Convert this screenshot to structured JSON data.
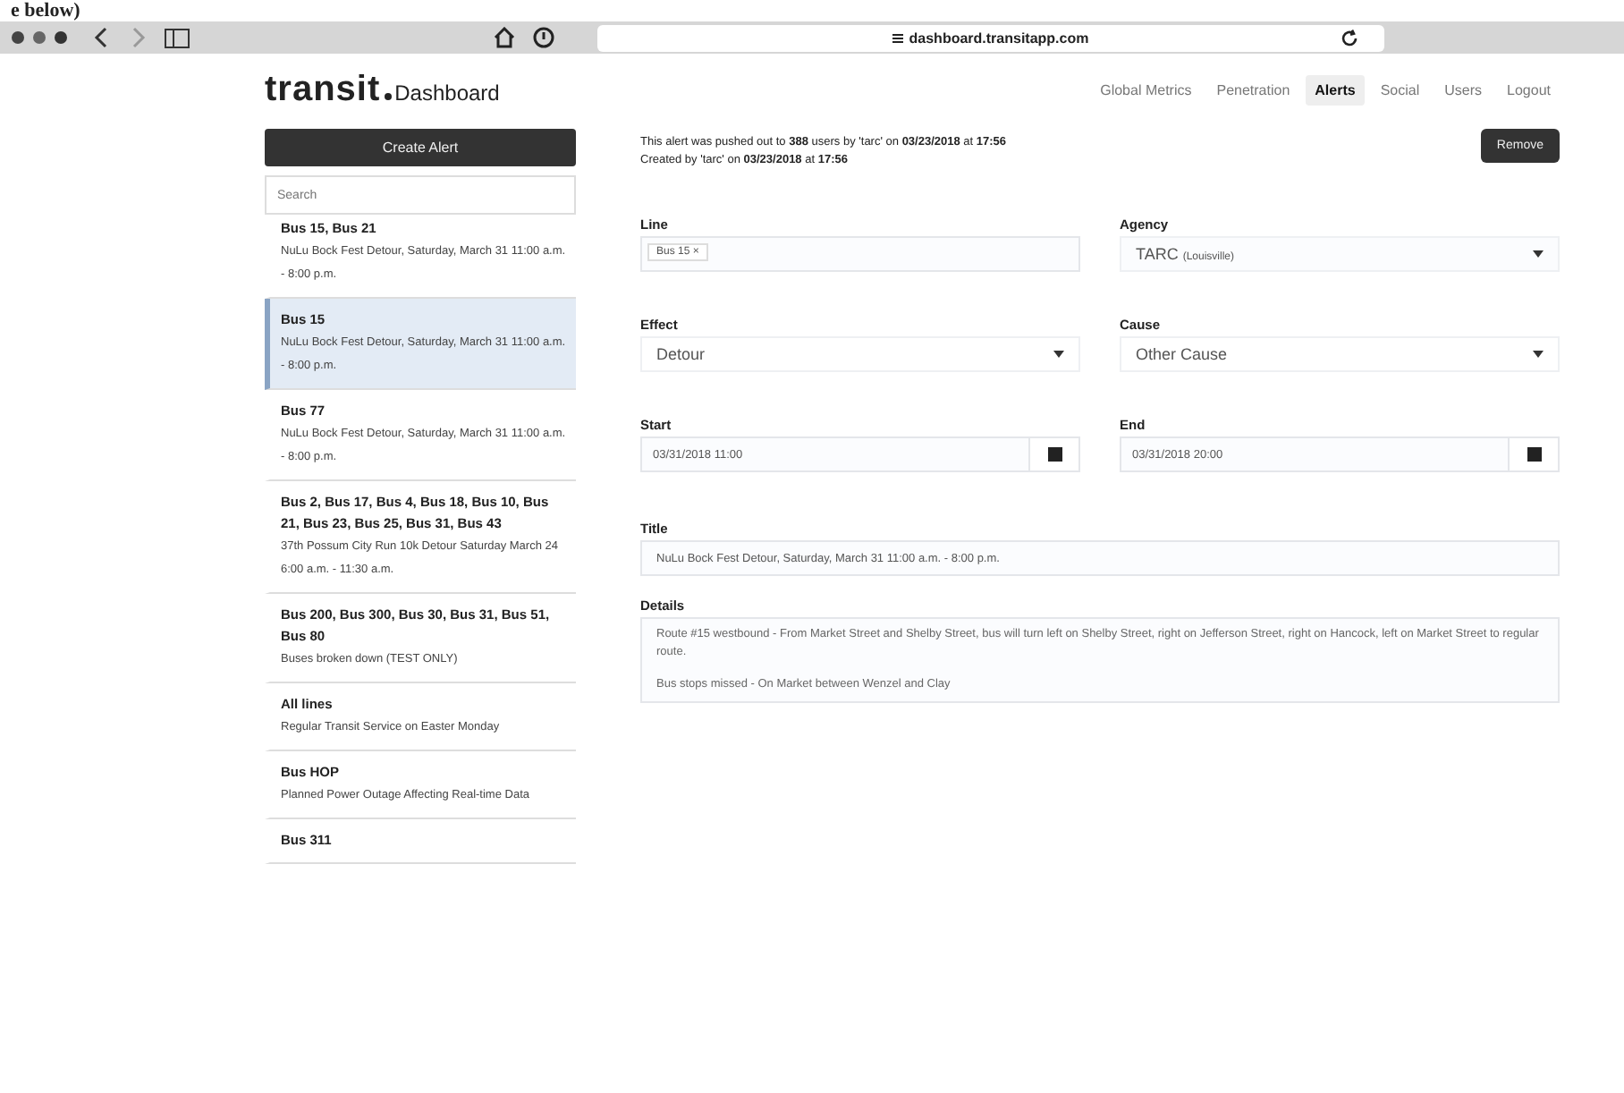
{
  "caption": "e below)",
  "browser": {
    "url": "dashboard.transitapp.com"
  },
  "header": {
    "logo": "transit",
    "subtitle": "Dashboard",
    "nav": [
      {
        "label": "Global Metrics",
        "selected": false
      },
      {
        "label": "Penetration",
        "selected": false
      },
      {
        "label": "Alerts",
        "selected": true
      },
      {
        "label": "Social",
        "selected": false
      },
      {
        "label": "Users",
        "selected": false
      },
      {
        "label": "Logout",
        "selected": false
      }
    ]
  },
  "sidebar": {
    "create_button": "Create Alert",
    "search": {
      "placeholder": "Search"
    },
    "alerts": [
      {
        "lines": "Bus 15, Bus 21",
        "text": "NuLu Bock Fest Detour, Saturday, March 31 11:00 a.m. - 8:00 p.m.",
        "selected": false
      },
      {
        "lines": "Bus 15",
        "text": "NuLu Bock Fest Detour, Saturday, March 31 11:00 a.m. - 8:00 p.m.",
        "selected": true
      },
      {
        "lines": "Bus 77",
        "text": "NuLu Bock Fest Detour, Saturday, March 31 11:00 a.m. - 8:00 p.m.",
        "selected": false
      },
      {
        "lines": "Bus 2, Bus 17, Bus 4, Bus 18, Bus 10, Bus 21, Bus 23, Bus 25, Bus 31, Bus 43",
        "text": "37th Possum City Run 10k Detour Saturday March 24 6:00 a.m. - 11:30 a.m.",
        "selected": false
      },
      {
        "lines": "Bus 200, Bus 300, Bus 30, Bus 31, Bus 51, Bus 80",
        "text": "Buses broken down (TEST ONLY)",
        "selected": false
      },
      {
        "lines": "All lines",
        "text": "Regular Transit Service on Easter Monday",
        "selected": false
      },
      {
        "lines": "Bus HOP",
        "text": "Planned Power Outage Affecting Real-time Data",
        "selected": false
      },
      {
        "lines": "Bus 311",
        "selected": false
      }
    ]
  },
  "alert": {
    "pushed_info": "This alert was pushed out to **388** users by 'tarc' on **03/23/2018** at **17:56**",
    "created_info": "Created by 'tarc' on **03/23/2018** at **17:56**",
    "remove_button": "Remove",
    "line": {
      "label": "Line",
      "tags": [
        "Bus 15 ×"
      ]
    },
    "agency": {
      "label": "Agency",
      "value": "TARC",
      "value_note": "(Louisville)"
    },
    "effect": {
      "label": "Effect",
      "value": "Detour"
    },
    "cause": {
      "label": "Cause",
      "value": "Other Cause"
    },
    "start": {
      "label": "Start",
      "value": "03/31/2018 11:00"
    },
    "end": {
      "label": "End",
      "value": "03/31/2018 20:00"
    },
    "title": {
      "label": "Title",
      "value": "NuLu Bock Fest Detour, Saturday, March 31 11:00 a.m. - 8:00 p.m."
    },
    "details": {
      "label": "Details",
      "paragraphs": [
        "Route #15 westbound - From Market Street and Shelby Street, bus will turn left on Shelby Street, right on Jefferson Street, right on Hancock, left on Market Street to regular route.",
        "Bus stops missed - On Market between Wenzel and Clay"
      ]
    }
  }
}
